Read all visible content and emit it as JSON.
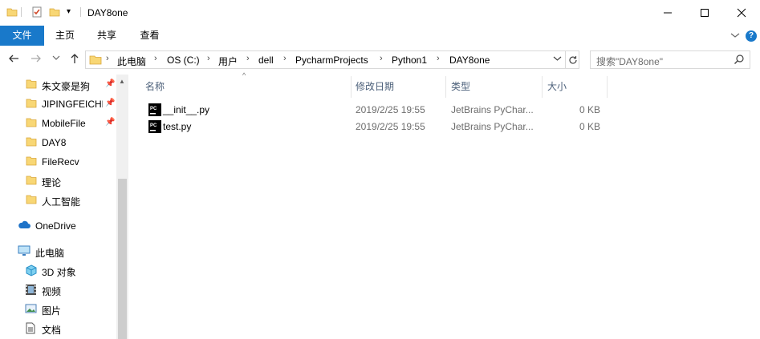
{
  "window": {
    "title": "DAY8one",
    "minimize_icon": "minimize-icon",
    "maximize_icon": "maximize-icon",
    "close_icon": "close-icon"
  },
  "ribbon": {
    "tabs": [
      "文件",
      "主页",
      "共享",
      "查看"
    ],
    "file_tab_color": "#1979ca"
  },
  "address": {
    "crumbs": [
      "此电脑",
      "OS (C:)",
      "用户",
      "dell",
      "PycharmProjects",
      "Python1",
      "DAY8one"
    ]
  },
  "search": {
    "placeholder": "搜索\"DAY8one\""
  },
  "sidebar": {
    "quick_access": [
      {
        "label": "朱文豪是狗",
        "pinned": true
      },
      {
        "label": "JIPINGFEICHE",
        "pinned": true
      },
      {
        "label": "MobileFile",
        "pinned": true
      },
      {
        "label": "DAY8",
        "pinned": false
      },
      {
        "label": "FileRecv",
        "pinned": false
      },
      {
        "label": "理论",
        "pinned": false
      },
      {
        "label": "人工智能",
        "pinned": false
      }
    ],
    "onedrive": "OneDrive",
    "this_pc": "此电脑",
    "pc_items": [
      "3D 对象",
      "视频",
      "图片",
      "文档"
    ]
  },
  "file_list": {
    "columns": [
      "名称",
      "修改日期",
      "类型",
      "大小"
    ],
    "rows": [
      {
        "name": "__init__.py",
        "modified": "2019/2/25 19:55",
        "type": "JetBrains PyChar...",
        "size": "0 KB"
      },
      {
        "name": "test.py",
        "modified": "2019/2/25 19:55",
        "type": "JetBrains PyChar...",
        "size": "0 KB"
      }
    ]
  }
}
